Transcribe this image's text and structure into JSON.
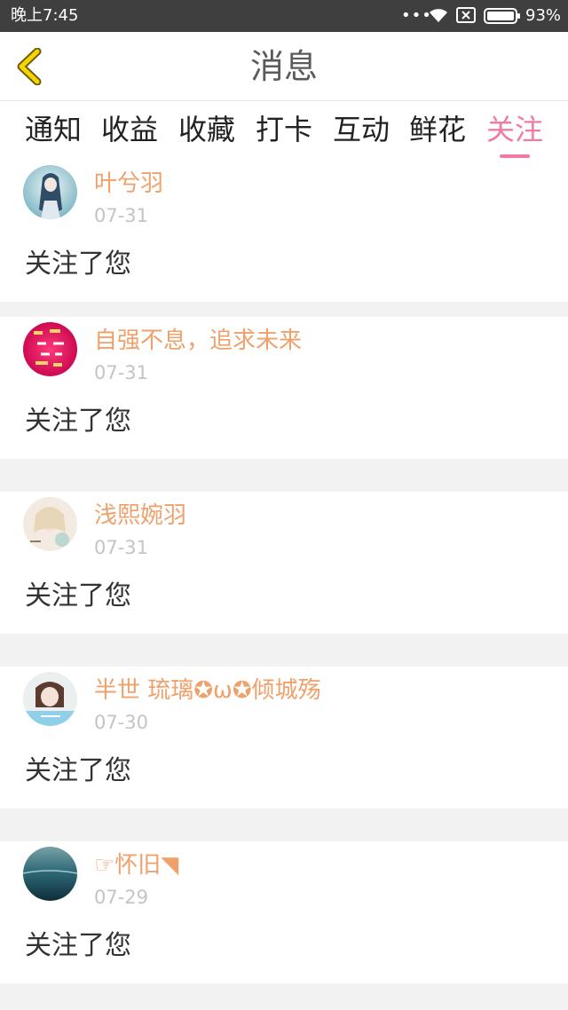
{
  "status_bar": {
    "time": "晚上7:45",
    "dots": "•••",
    "battery_percent": "93%",
    "icons": [
      "wifi-icon",
      "sim-x-icon",
      "battery-icon"
    ]
  },
  "header": {
    "title": "消息",
    "back_icon": "chevron-left-icon"
  },
  "tabs": [
    {
      "label": "通知"
    },
    {
      "label": "收益"
    },
    {
      "label": "收藏"
    },
    {
      "label": "打卡"
    },
    {
      "label": "互动"
    },
    {
      "label": "鲜花"
    },
    {
      "label": "关注",
      "active": true
    }
  ],
  "colors": {
    "accent": "#f07aa4",
    "name": "#f0a06a",
    "back_icon": "#f0c400"
  },
  "notifications": [
    {
      "name": "叶兮羽",
      "date": "07-31",
      "message": "关注了您",
      "avatar": "avatar-anime-girl"
    },
    {
      "name": "自强不息，追求未来",
      "date": "07-31",
      "message": "关注了您",
      "avatar": "avatar-pink-text"
    },
    {
      "name": "浅熙婉羽",
      "date": "07-31",
      "message": "关注了您",
      "avatar": "avatar-illustration"
    },
    {
      "name": "半世 琉璃✪ω✪倾城殇",
      "date": "07-30",
      "message": "关注了您",
      "avatar": "avatar-photo"
    },
    {
      "name": "☞怀旧◥",
      "date": "07-29",
      "message": "关注了您",
      "avatar": "avatar-sea"
    }
  ]
}
